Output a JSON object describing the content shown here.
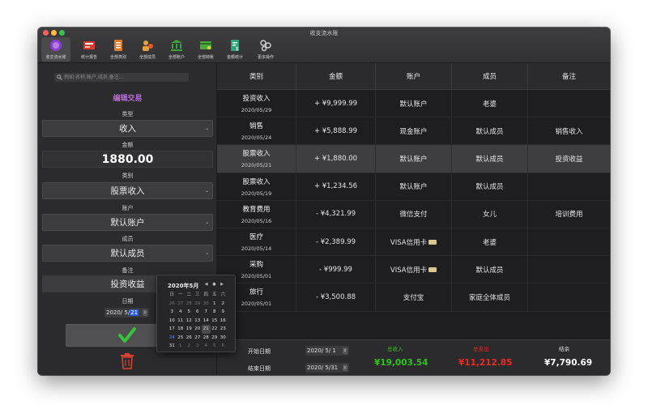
{
  "window": {
    "title": "收支流水账"
  },
  "toolbar": {
    "items": [
      {
        "label": "收支流水账",
        "icon": "ledger-icon"
      },
      {
        "label": "统计报告",
        "icon": "report-icon"
      },
      {
        "label": "全部类别",
        "icon": "categories-icon"
      },
      {
        "label": "全部成员",
        "icon": "members-icon"
      },
      {
        "label": "全部账户",
        "icon": "bank-icon"
      },
      {
        "label": "全部转账",
        "icon": "transfer-icon"
      },
      {
        "label": "金额统计",
        "icon": "amount-stats-icon"
      },
      {
        "label": "更多操作",
        "icon": "more-icon"
      }
    ]
  },
  "search": {
    "placeholder": "例如:名称,账户,成员,备注..."
  },
  "editor": {
    "title": "编辑交易",
    "type_label": "类型",
    "type_value": "收入",
    "amount_label": "金额",
    "amount_value": "1880.00",
    "category_label": "类别",
    "category_value": "股票收入",
    "account_label": "账户",
    "account_value": "默认账户",
    "member_label": "成员",
    "member_value": "默认成员",
    "note_label": "备注",
    "note_value": "投资收益",
    "date_label": "日期",
    "date_prefix": "2020/  5/",
    "date_day": "21"
  },
  "calendar": {
    "month_label": "2020年5月",
    "weekdays": [
      "日",
      "一",
      "二",
      "三",
      "四",
      "五",
      "六"
    ],
    "weeks": [
      [
        "26",
        "27",
        "28",
        "29",
        "30",
        "1",
        "2"
      ],
      [
        "3",
        "4",
        "5",
        "6",
        "7",
        "8",
        "9"
      ],
      [
        "10",
        "11",
        "12",
        "13",
        "14",
        "15",
        "16"
      ],
      [
        "17",
        "18",
        "19",
        "20",
        "21",
        "22",
        "23"
      ],
      [
        "24",
        "25",
        "26",
        "27",
        "28",
        "29",
        "30"
      ],
      [
        "31",
        "1",
        "2",
        "3",
        "4",
        "5",
        "6"
      ]
    ]
  },
  "table": {
    "headers": [
      "类别",
      "金额",
      "账户",
      "成员",
      "备注"
    ],
    "rows": [
      {
        "category": "投资收入",
        "date": "2020/05/29",
        "amount": "+ ¥9,999.99",
        "account": "默认账户",
        "member": "老婆",
        "note": ""
      },
      {
        "category": "销售",
        "date": "2020/05/24",
        "amount": "+ ¥5,888.99",
        "account": "现金账户",
        "member": "默认成员",
        "note": "销售收入"
      },
      {
        "category": "股票收入",
        "date": "2020/05/21",
        "amount": "+ ¥1,880.00",
        "account": "默认账户",
        "member": "默认成员",
        "note": "投资收益"
      },
      {
        "category": "股票收入",
        "date": "2020/05/19",
        "amount": "+ ¥1,234.56",
        "account": "默认账户",
        "member": "默认成员",
        "note": ""
      },
      {
        "category": "教育费用",
        "date": "2020/05/16",
        "amount": "- ¥4,321.99",
        "account": "微信支付",
        "member": "女儿",
        "note": "培训费用"
      },
      {
        "category": "医疗",
        "date": "2020/05/14",
        "amount": "- ¥2,389.99",
        "account": "VISA信用卡",
        "member": "老婆",
        "note": ""
      },
      {
        "category": "采购",
        "date": "2020/05/01",
        "amount": "- ¥999.99",
        "account": "VISA信用卡",
        "member": "默认成员",
        "note": ""
      },
      {
        "category": "旅行",
        "date": "2020/05/01",
        "amount": "- ¥3,500.88",
        "account": "支付宝",
        "member": "家庭全体成员",
        "note": ""
      }
    ]
  },
  "footer": {
    "start_label": "开始日期",
    "end_label": "结束日期",
    "start_date": "2020/  5/  1",
    "end_date": "2020/  5/31",
    "income_label": "总收入",
    "income_value": "¥19,003.54",
    "expense_label": "总支出",
    "expense_value": "¥11,212.85",
    "balance_label": "结余",
    "balance_value": "¥7,790.69"
  },
  "colors": {
    "income": "#2ec41c",
    "expense": "#ee2a1f",
    "accent_purple": "#b66bd8",
    "confirm_check": "#36c43a",
    "trash": "#e0422f"
  }
}
